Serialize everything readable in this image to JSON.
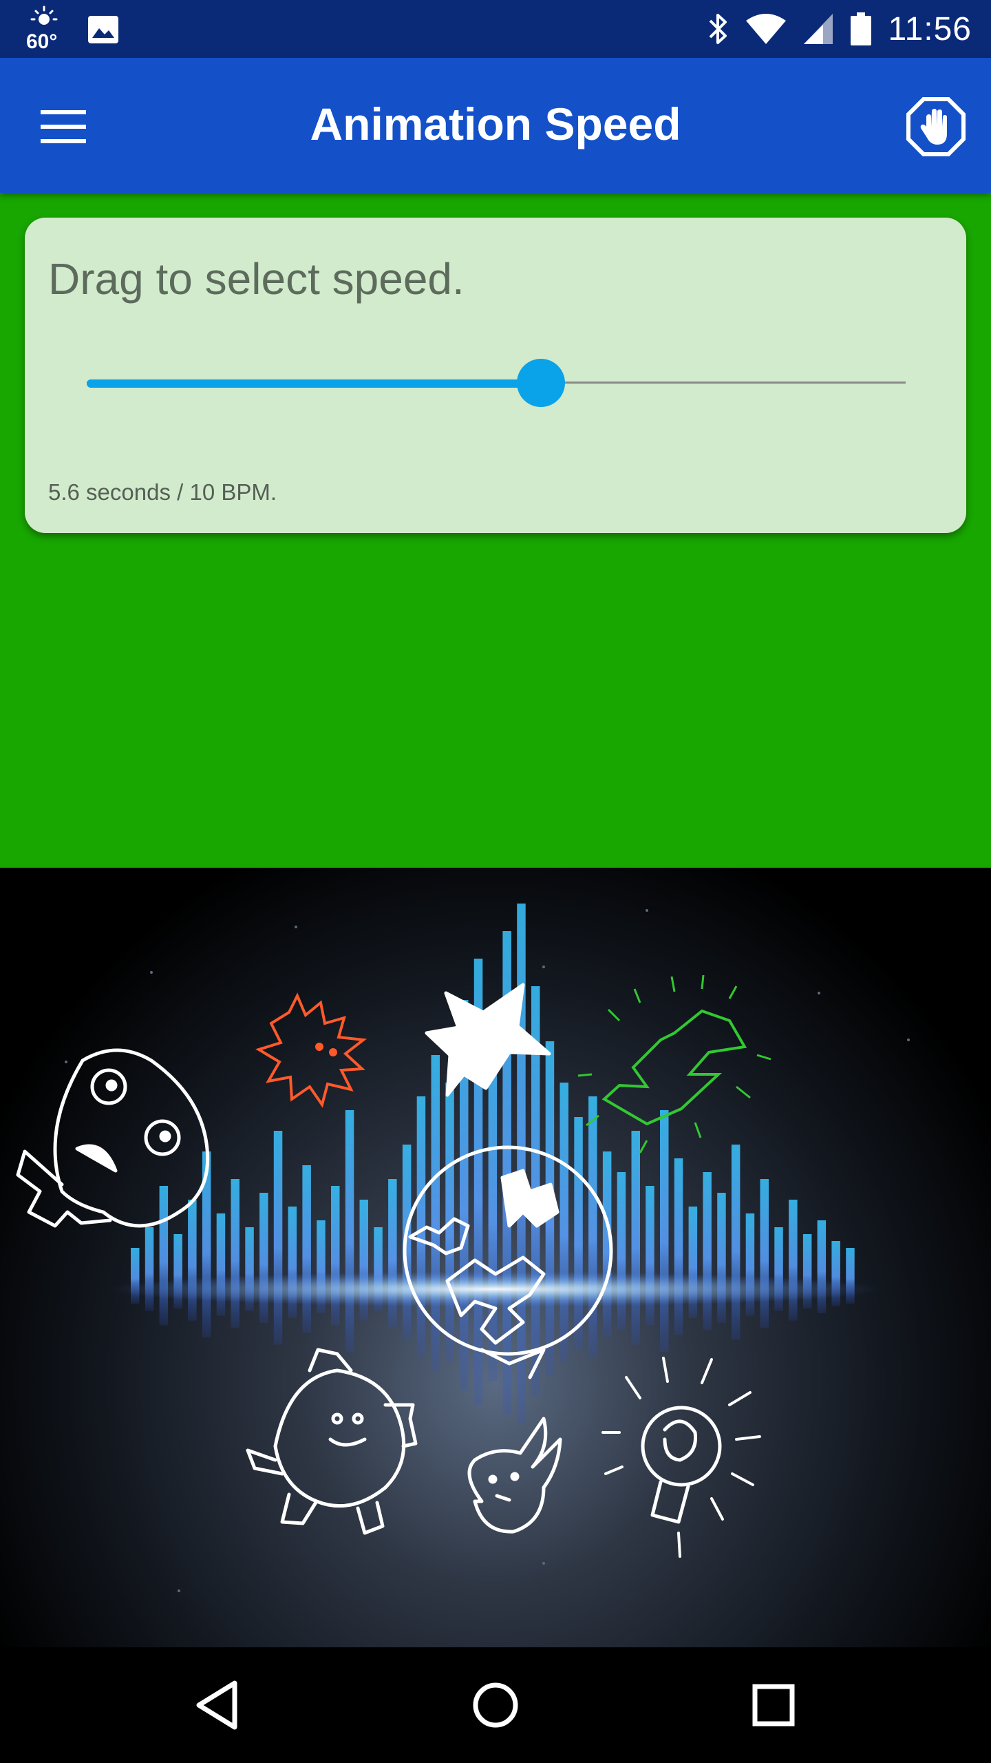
{
  "status_bar": {
    "temperature": "60°",
    "time": "11:56",
    "icons": [
      "weather-sun-icon",
      "image-notification-icon",
      "bluetooth-icon",
      "wifi-icon",
      "cell-signal-icon",
      "battery-icon"
    ]
  },
  "app_bar": {
    "title": "Animation Speed",
    "menu_icon": "hamburger-menu-icon",
    "action_icon": "stop-hand-icon",
    "color": "#1451c9"
  },
  "speed_card": {
    "prompt": "Drag to select speed.",
    "slider_fraction": 0.555,
    "status": "5.6 seconds / 10 BPM.",
    "accent_color": "#0aa2e8",
    "card_color": "#d2ebcc"
  },
  "background_color": "#18a600",
  "navigation": {
    "icons": [
      "back-triangle-icon",
      "home-circle-icon",
      "recents-square-icon"
    ]
  }
}
